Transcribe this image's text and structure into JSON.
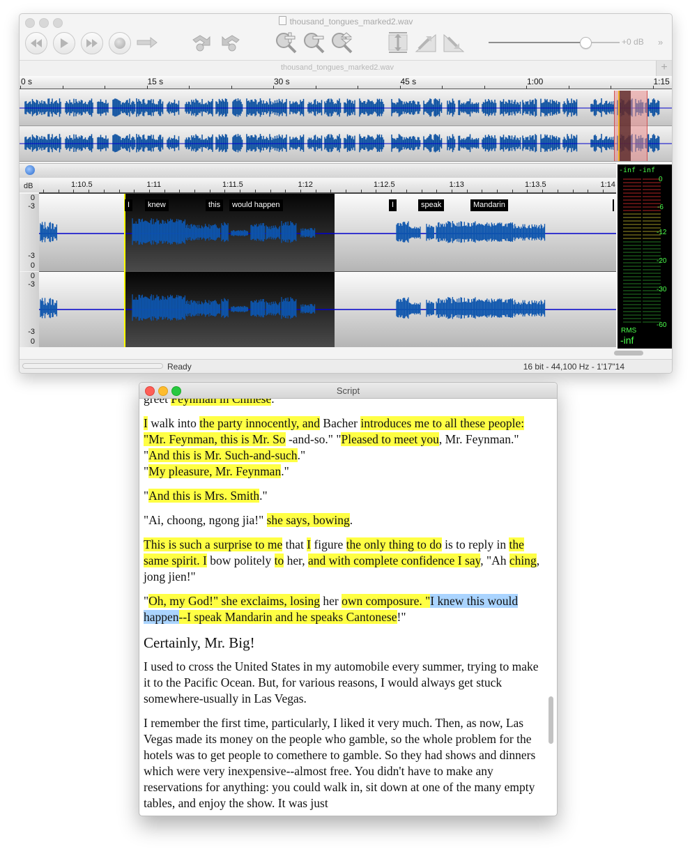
{
  "main_window": {
    "title": "thousand_tongues_marked2.wav",
    "toolbar": {
      "buttons": [
        {
          "name": "rewind",
          "icon": "rewind-icon"
        },
        {
          "name": "play",
          "icon": "play-icon"
        },
        {
          "name": "fast-forward",
          "icon": "fast-forward-icon"
        },
        {
          "name": "record",
          "icon": "record-icon"
        },
        {
          "name": "go-to",
          "icon": "arrow-right-icon"
        },
        {
          "name": "undo",
          "icon": "undo-icon"
        },
        {
          "name": "redo",
          "icon": "redo-icon"
        },
        {
          "name": "zoom-in",
          "icon": "zoom-in-icon"
        },
        {
          "name": "zoom-out",
          "icon": "zoom-out-icon"
        },
        {
          "name": "zoom-fit",
          "icon": "zoom-fit-icon"
        },
        {
          "name": "fit-vertical",
          "icon": "fit-vertical-icon"
        },
        {
          "name": "fade-in",
          "icon": "fade-in-icon"
        },
        {
          "name": "fade-out",
          "icon": "fade-out-icon"
        }
      ],
      "volume": {
        "label": "+0 dB",
        "value_fraction": 0.74
      },
      "more_label": "»"
    },
    "tab": {
      "label": "thousand_tongues_marked2.wav",
      "add_label": "+"
    },
    "overview": {
      "ticks": [
        "0 s",
        "15 s",
        "30 s",
        "45 s",
        "1:00",
        "1:15"
      ]
    },
    "detail": {
      "db_label": "dB",
      "ticks": [
        "1:10.5",
        "1:11",
        "1:11.5",
        "1:12",
        "1:12.5",
        "1:13",
        "1:13.5",
        "1:14"
      ],
      "db_scale": {
        "top": "0",
        "upper": "-3",
        "lower": "-3",
        "bottom": "0"
      },
      "words": [
        "I",
        "knew",
        "this",
        "would happen",
        "I",
        "speak",
        "Mandarin"
      ]
    },
    "meter": {
      "peak_left": "-inf",
      "peak_right": "-inf",
      "scale": [
        "0",
        "-6",
        "-12",
        "-20",
        "-30",
        "-60"
      ],
      "rms_label": "RMS",
      "rms_value": "-inf"
    },
    "status": {
      "text": "Ready",
      "format": "16 bit - 44,100 Hz - 1'17\"14"
    },
    "colors": {
      "waveform": "#0a4fa0",
      "center_line": "#0000cc",
      "cursor": "#ffff00",
      "selection_overview": "#e8a8a8"
    }
  },
  "script_window": {
    "title": "Script",
    "paragraphs": [
      {
        "type": "p",
        "runs": [
          [
            "greet ",
            ""
          ],
          [
            "Feynman in Chinese",
            "hl"
          ],
          [
            ".",
            ""
          ]
        ]
      },
      {
        "type": "p",
        "runs": [
          [
            "I",
            "hl"
          ],
          [
            " walk into ",
            ""
          ],
          [
            "the party innocently, and",
            "hl"
          ],
          [
            " Bacher ",
            ""
          ],
          [
            "introduces me to all these people: \"Mr. Feynman, this is Mr. So",
            "hl"
          ],
          [
            " -and-so.\" \"",
            ""
          ],
          [
            "Pleased to meet you",
            "hl"
          ],
          [
            ", Mr. Feynman.\"",
            ""
          ],
          [
            "\n",
            "br"
          ],
          [
            "\"",
            ""
          ],
          [
            "And this is Mr. Such-and-such",
            "hl"
          ],
          [
            ".\"",
            ""
          ],
          [
            "\n",
            "br"
          ],
          [
            "\"",
            ""
          ],
          [
            "My pleasure, Mr. Feynman",
            "hl"
          ],
          [
            ".\"",
            ""
          ]
        ]
      },
      {
        "type": "p",
        "runs": [
          [
            "\"",
            ""
          ],
          [
            "And this is Mrs. Smith",
            "hl"
          ],
          [
            ".\"",
            ""
          ]
        ]
      },
      {
        "type": "p",
        "runs": [
          [
            "\"Ai, choong, ngong jia!\" ",
            ""
          ],
          [
            "she says, bowing",
            "hl"
          ],
          [
            ".",
            ""
          ]
        ]
      },
      {
        "type": "p",
        "runs": [
          [
            "This is such a surprise to me",
            "hl"
          ],
          [
            " that ",
            ""
          ],
          [
            "I",
            "hl"
          ],
          [
            " figure ",
            ""
          ],
          [
            "the only thing to do",
            "hl"
          ],
          [
            " is to reply in ",
            ""
          ],
          [
            "the same spirit. I",
            "hl"
          ],
          [
            " bow politely ",
            ""
          ],
          [
            "to",
            "hl"
          ],
          [
            " her, ",
            ""
          ],
          [
            "and with complete confidence I say",
            "hl"
          ],
          [
            ", \"Ah ",
            ""
          ],
          [
            "ching",
            "hl"
          ],
          [
            ", jong jien!\"",
            ""
          ]
        ]
      },
      {
        "type": "p",
        "runs": [
          [
            "\"",
            ""
          ],
          [
            "Oh, my God!\" she exclaims, losing",
            "hl"
          ],
          [
            " her ",
            ""
          ],
          [
            "own composure. \"",
            "hl"
          ],
          [
            "I knew this would happen",
            "sel"
          ],
          [
            "--I speak Mandarin and he speaks Cantonese",
            "hl"
          ],
          [
            "!\"",
            ""
          ]
        ]
      },
      {
        "type": "heading",
        "runs": [
          [
            "Certainly, Mr. Big!",
            ""
          ]
        ]
      },
      {
        "type": "p",
        "runs": [
          [
            "I used to cross the United States in my automobile every summer, trying to make it to the Pacific Ocean. But, for various reasons, I would always get stuck somewhere-usually in Las Vegas.",
            ""
          ]
        ]
      },
      {
        "type": "p",
        "runs": [
          [
            "I remember the first time, particularly, I liked it very much. Then, as now, Las Vegas made its money on the people who gamble, so the whole problem for the hotels was to get people to comethere to gamble. So they had shows and dinners which were very inexpensive--almost free. You didn't have to make any reservations for anything: you could walk in, sit down at one of the many empty tables, and enjoy the show. It was just",
            ""
          ]
        ]
      }
    ],
    "colors": {
      "highlight": "#ffff44",
      "selection": "#aad4ff"
    }
  }
}
